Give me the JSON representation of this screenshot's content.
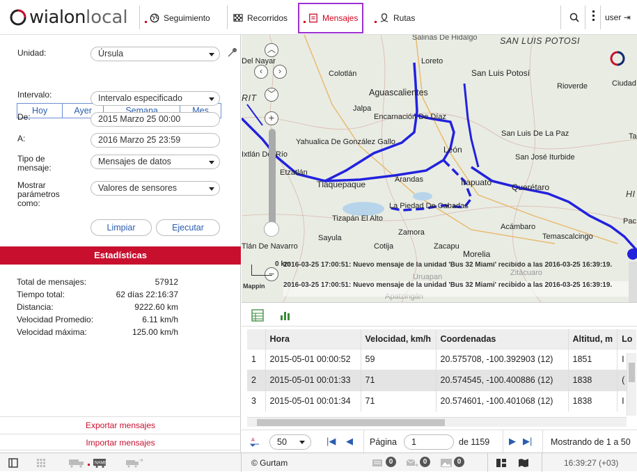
{
  "header": {
    "logo_text": "wialon",
    "logo_suffix": "local",
    "nav": [
      {
        "label": "Seguimiento"
      },
      {
        "label": "Recorridos"
      },
      {
        "label": "Mensajes"
      },
      {
        "label": "Rutas"
      }
    ],
    "user_label": "user",
    "accent": "#c8102e",
    "active_border": "#9b30d0"
  },
  "form": {
    "unit_label": "Unidad:",
    "unit_value": "Úrsula",
    "periods": [
      "Hoy",
      "Ayer",
      "Semana",
      "Mes"
    ],
    "interval_label": "Intervalo:",
    "interval_value": "Intervalo especificado",
    "from_label": "De:",
    "from_value": "2015 Marzo 25 00:00",
    "to_label": "A:",
    "to_value": "2016 Marzo 25 23:59",
    "msgtype_label": "Tipo de mensaje:",
    "msgtype_value": "Mensajes de datos",
    "params_label": "Mostrar parámetros como:",
    "params_value": "Valores de sensores",
    "clear_label": "Limpiar",
    "run_label": "Ejecutar"
  },
  "stats": {
    "title": "Estadísticas",
    "rows": [
      {
        "k": "Total de mensajes:",
        "v": "57912"
      },
      {
        "k": "Tiempo total:",
        "v": "62 días 22:16:37"
      },
      {
        "k": "Distancia:",
        "v": "9222.60 km"
      },
      {
        "k": "Velocidad Promedio:",
        "v": "6.11 km/h"
      },
      {
        "k": "Velocidad máxima:",
        "v": "125.00 km/h"
      }
    ],
    "export_label": "Exportar mensajes",
    "import_label": "Importar mensajes"
  },
  "map": {
    "places": [
      "Salinas De Hidalgo",
      "SAN LUIS POTOSI",
      "Loreto",
      "San Luis Potosí",
      "Rioverde",
      "Ciudad",
      "Colotlán",
      "Aguascalientes",
      "Jalpa",
      "Encarnación De Díaz",
      "Yahualica De González Gallo",
      "León",
      "San Luis De La Paz",
      "San José Iturbide",
      "Tlaquepaque",
      "Arandas",
      "Irapuato",
      "Querétaro",
      "La Piedad De Cabadas",
      "Tizapán El Alto",
      "Zamora",
      "Acámbaro",
      "Sayula",
      "Cotija",
      "Zacapu",
      "Morelia",
      "Temascalcingo",
      "Etzatlán",
      "Ixtlán Del Río",
      "Tlán De Navarro",
      "Del Nayar",
      "HI",
      "Pac",
      "Ta",
      "RIT",
      "Uruapan",
      "Zitácuaro",
      "Apatzingán",
      "Mappin"
    ],
    "scale_label": "0 km",
    "notifications": [
      "2016-03-25 17:00:51: Nuevo mensaje de la unidad 'Bus 32 Miami' recibido a las 2016-03-25 16:39:19.",
      "2016-03-25 17:00:51: Nuevo mensaje de la unidad 'Bus 32 Miami' recibido a las 2016-03-25 16:39:19."
    ],
    "track_color": "#2222dd"
  },
  "table": {
    "columns": [
      "",
      "Hora",
      "Velocidad, km/h",
      "Coordenadas",
      "Altitud, m",
      "Lo"
    ],
    "rows": [
      [
        "1",
        "2015-05-01 00:00:52",
        "59",
        "20.575708, -100.392903 (12)",
        "1851",
        "I"
      ],
      [
        "2",
        "2015-05-01 00:01:33",
        "71",
        "20.574545, -100.400886 (12)",
        "1838",
        "("
      ],
      [
        "3",
        "2015-05-01 00:01:34",
        "71",
        "20.574601, -100.401068 (12)",
        "1838",
        "I"
      ]
    ]
  },
  "pager": {
    "page_size": "50",
    "page_label": "Página",
    "page_value": "1",
    "of_label": "de 1159",
    "showing": "Mostrando de 1 a 50"
  },
  "footer": {
    "copyright": "© Gurtam",
    "badge_counts": [
      "0",
      "0",
      "0"
    ],
    "time": "16:39:27 (+03)"
  }
}
